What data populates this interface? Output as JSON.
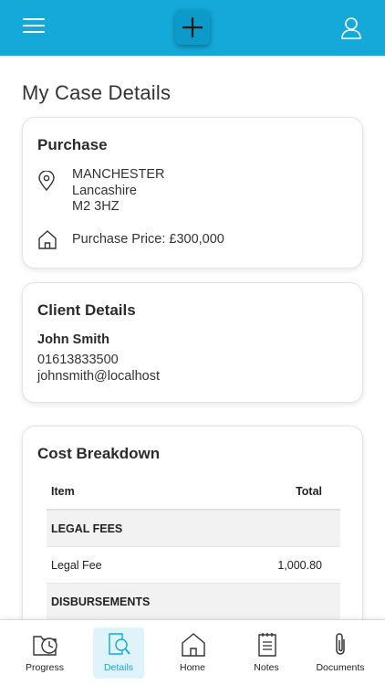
{
  "header": {
    "menu_icon": "hamburger-menu-icon",
    "add_icon": "plus-icon",
    "user_icon": "user-profile-icon",
    "bar_color": "#14a9d9"
  },
  "page": {
    "title": "My Case Details"
  },
  "purchase": {
    "title": "Purchase",
    "location_icon": "location-pin-icon",
    "address_lines": [
      "MANCHESTER",
      "Lancashire",
      "M2 3HZ"
    ],
    "home_icon": "house-icon",
    "price_text": "Purchase Price: £300,000"
  },
  "client": {
    "title": "Client Details",
    "name": "John Smith",
    "phone": "01613833500",
    "email": "johnsmith@localhost"
  },
  "cost": {
    "title": "Cost Breakdown",
    "columns": [
      "Item",
      "Total"
    ],
    "rows": [
      {
        "type": "section",
        "item": "LEGAL FEES",
        "total": ""
      },
      {
        "type": "line",
        "item": "Legal Fee",
        "total": "1,000.80"
      },
      {
        "type": "section",
        "item": "DISBURSEMENTS",
        "total": ""
      }
    ]
  },
  "tabs": [
    {
      "label": "Progress",
      "icon": "progress-clock-icon",
      "active": false
    },
    {
      "label": "Details",
      "icon": "search-document-icon",
      "active": true
    },
    {
      "label": "Home",
      "icon": "home-icon",
      "active": false
    },
    {
      "label": "Notes",
      "icon": "notepad-icon",
      "active": false
    },
    {
      "label": "Documents",
      "icon": "paperclip-icon",
      "active": false
    }
  ]
}
